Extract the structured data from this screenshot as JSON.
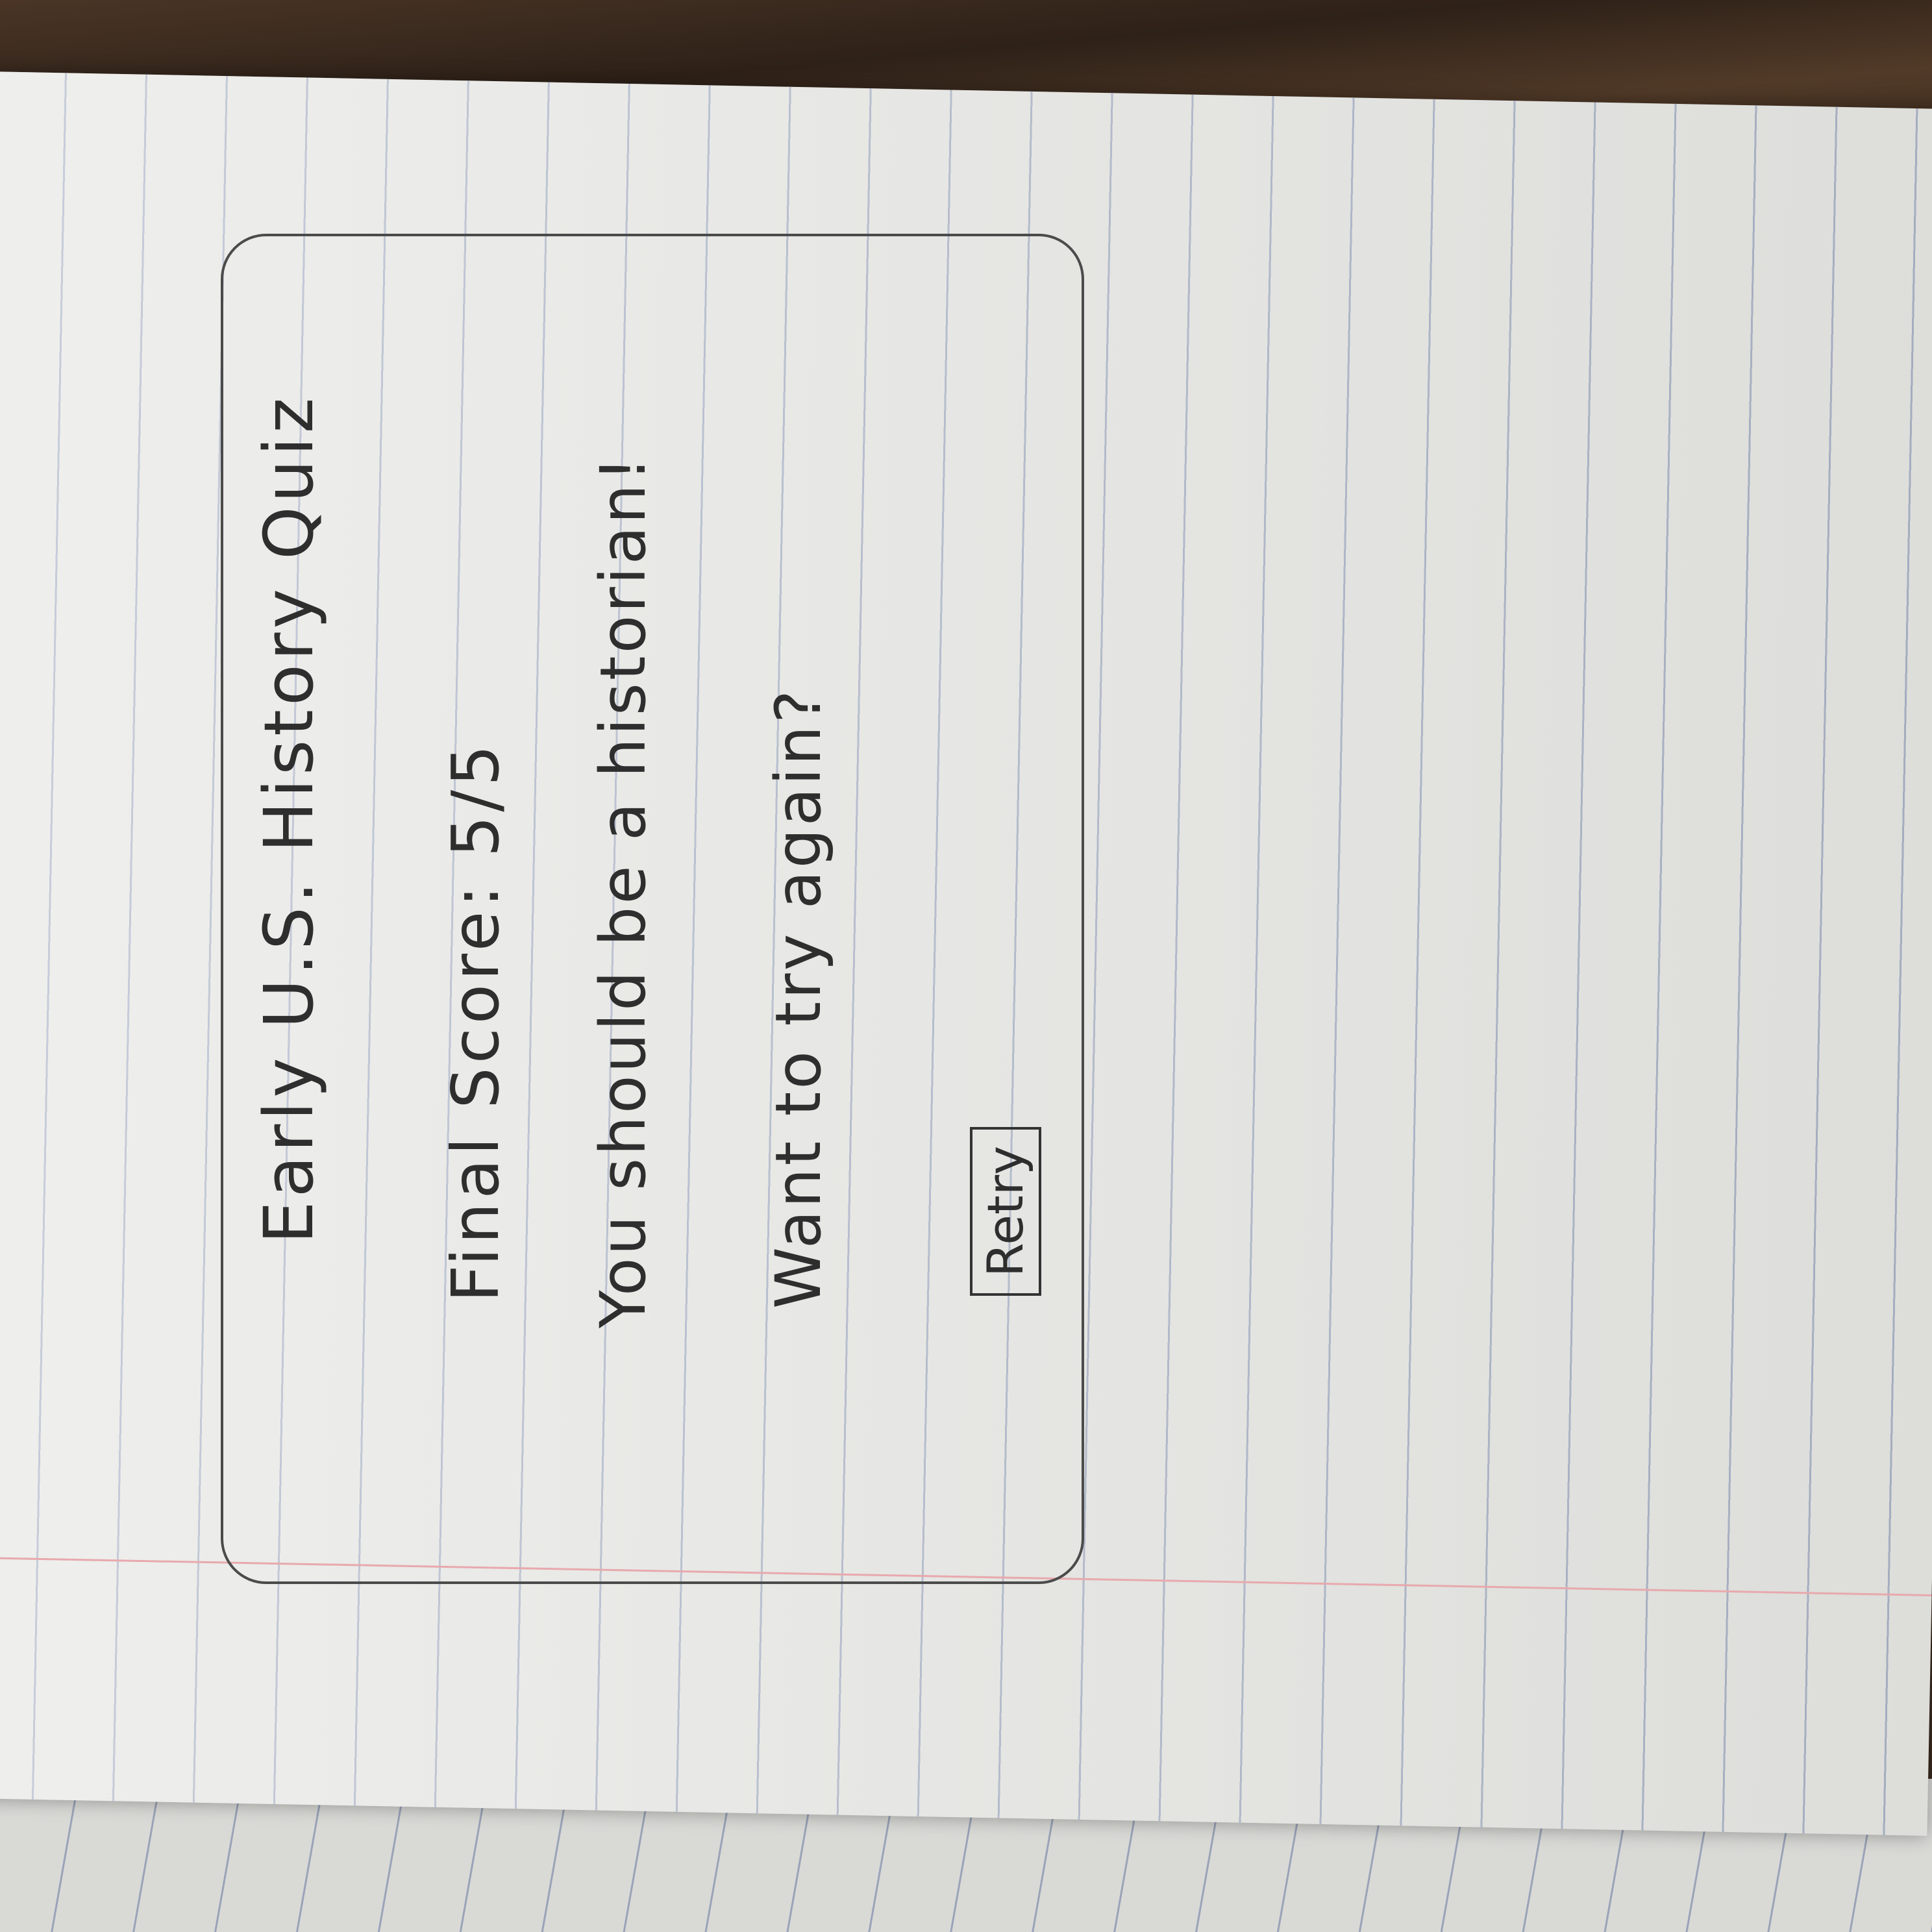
{
  "quiz": {
    "title": "Early U.S. History Quiz",
    "final_score": "Final Score: 5/5",
    "result_message": "You should be a historian!",
    "retry_prompt": "Want to try again?",
    "retry_button_label": "Retry"
  }
}
